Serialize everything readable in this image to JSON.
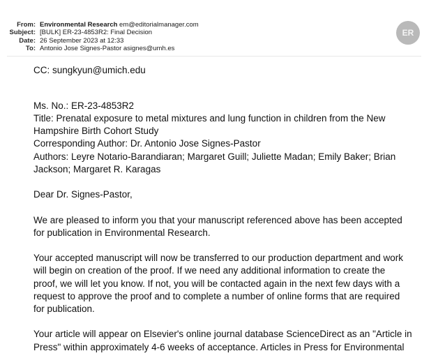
{
  "header": {
    "from_label": "From:",
    "from_name": "Environmental Research",
    "from_email": "em@editorialmanager.com",
    "subject_label": "Subject:",
    "subject": "[BULK] ER-23-4853R2: Final Decision",
    "date_label": "Date:",
    "date": "26 September 2023 at 12:33",
    "to_label": "To:",
    "to": "Antonio Jose Signes-Pastor asignes@umh.es",
    "avatar_initials": "ER"
  },
  "body": {
    "cc": "CC: sungkyun@umich.edu",
    "ms_no": "Ms. No.: ER-23-4853R2",
    "title_l1": "Title: Prenatal exposure to metal mixtures and lung function in children from the New",
    "title_l2": "Hampshire Birth Cohort Study",
    "corresponding": "Corresponding Author: Dr. Antonio Jose Signes-Pastor",
    "authors_l1": "Authors: Leyre Notario-Barandiaran; Margaret Guill; Juliette Madan; Emily Baker; Brian",
    "authors_l2": "Jackson; Margaret R. Karagas",
    "greeting": "Dear Dr. Signes-Pastor,",
    "p1_l1": "We are pleased to inform you that your manuscript referenced above has been accepted",
    "p1_l2": "for publication in Environmental Research.",
    "p2_l1": "Your accepted manuscript will now be transferred to our production department and work",
    "p2_l2": "will begin on creation of the proof. If we need any additional information to create the",
    "p2_l3": "proof, we will let you know. If not, you will be contacted again in the next few days with a",
    "p2_l4": "request to approve the proof and to complete a number of online forms that are required",
    "p2_l5": "for publication.",
    "p3_l1": "Your article will appear on Elsevier's online journal database ScienceDirect as an \"Article in",
    "p3_l2": "Press\" within approximately 4-6 weeks of acceptance. Articles in Press for Environmental"
  }
}
